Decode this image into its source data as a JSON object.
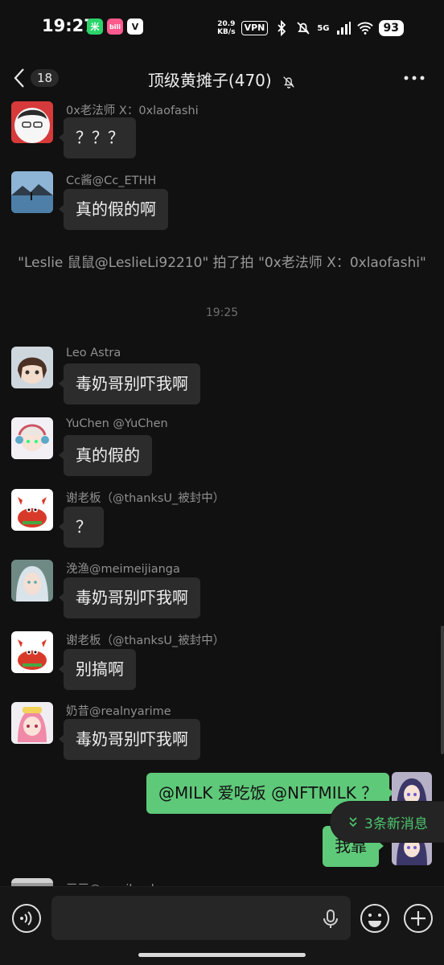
{
  "status_bar": {
    "time": "19:27",
    "net_speed_value": "20.9",
    "net_speed_unit": "KB/s",
    "vpn": "VPN",
    "network": "5G",
    "battery": "93",
    "app_badges": [
      "mi-home-icon",
      "bilibili-icon",
      "v-app-icon"
    ],
    "app_badge_labels": [
      "米",
      "bili",
      "V"
    ]
  },
  "header": {
    "back_count": "18",
    "title": "顶级黄摊子(470)"
  },
  "messages": [
    {
      "sender": "0x老法师 X：0xlaofashi",
      "text": "？？？",
      "avatar": "avatar-anime-glasses"
    },
    {
      "sender": "Cc酱@Cc_ETHH",
      "text": "真的假的啊",
      "avatar": "avatar-lake-photo"
    },
    {
      "sender": "Leo Astra",
      "text": "毒奶哥别吓我啊",
      "avatar": "avatar-anime-girl-brown"
    },
    {
      "sender": "YuChen @YuChen",
      "text": "真的假的",
      "avatar": "avatar-anime-headphones"
    },
    {
      "sender": "谢老板（@thanksU_被封中）",
      "text": "？",
      "avatar": "avatar-crab"
    },
    {
      "sender": "浼渔@meimeijianga",
      "text": "毒奶哥别吓我啊",
      "avatar": "avatar-white-hair"
    },
    {
      "sender": "谢老板（@thanksU_被封中）",
      "text": "别搞啊",
      "avatar": "avatar-crab"
    },
    {
      "sender": "奶昔@realnyarime",
      "text": "毒奶哥别吓我啊",
      "avatar": "avatar-pink-hair"
    },
    {
      "sender": "三三@sumiloudo",
      "text": "",
      "avatar": "avatar-grey"
    }
  ],
  "system_note": "\"Leslie 鼠鼠@LeslieLi92210\" 拍了拍 \"0x老法师 X：0xlaofashi\"",
  "time_divider": "19:25",
  "my_messages": [
    {
      "text": "@MILK 爱吃饭 @NFTMILK ？"
    },
    {
      "text": "我靠"
    }
  ],
  "new_messages_label": "3条新消息",
  "input": {
    "value": "",
    "placeholder": ""
  },
  "colors": {
    "background": "#111111",
    "bubble_other": "#2c2c2c",
    "bubble_me": "#5fc97a",
    "accent": "#4cc56e"
  }
}
